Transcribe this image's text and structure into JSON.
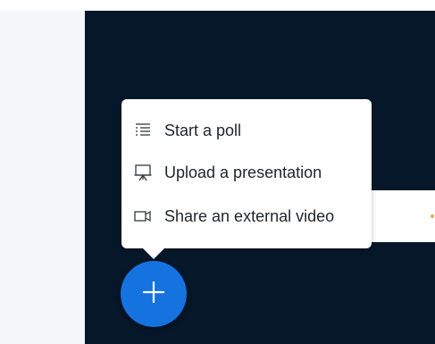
{
  "menu": {
    "items": [
      {
        "label": "Start a poll",
        "icon": "poll-list-icon"
      },
      {
        "label": "Upload a presentation",
        "icon": "presentation-screen-icon"
      },
      {
        "label": "Share an external video",
        "icon": "video-camera-icon"
      }
    ]
  },
  "action_button": {
    "icon": "plus-icon"
  },
  "colors": {
    "primary": "#1573df",
    "dark_background": "#06172a",
    "sidebar_background": "#f4f6fa",
    "text": "#1f252b"
  }
}
